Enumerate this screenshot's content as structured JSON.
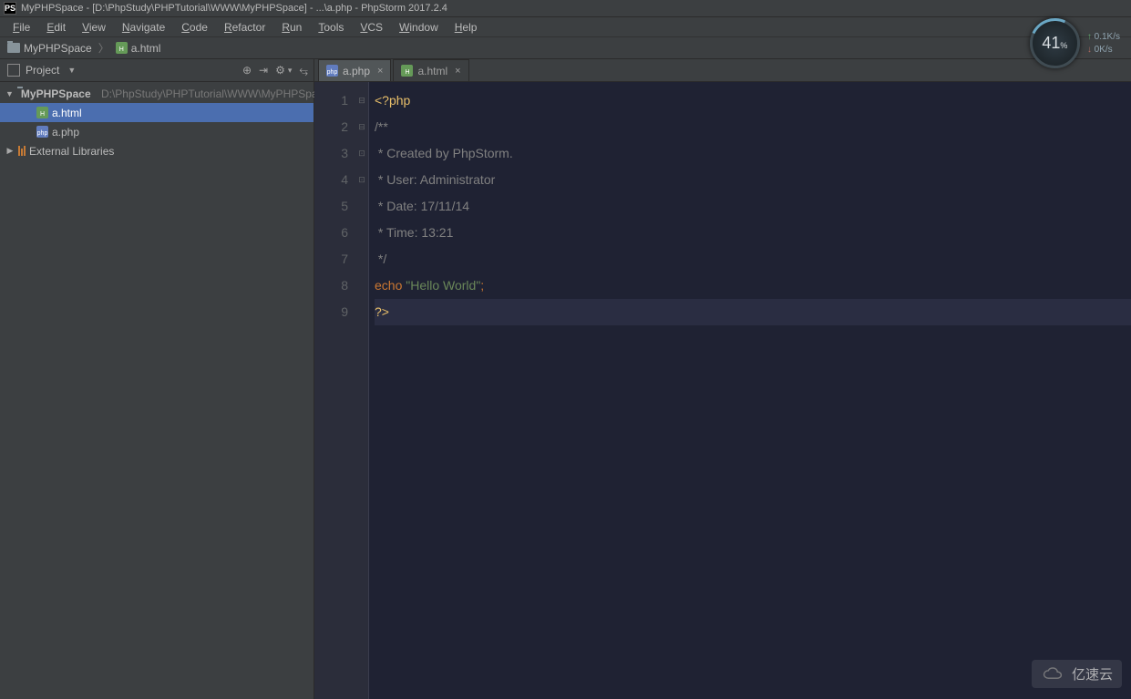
{
  "title_bar": "MyPHPSpace - [D:\\PhpStudy\\PHPTutorial\\WWW\\MyPHPSpace] - ...\\a.php - PhpStorm 2017.2.4",
  "logo_text": "PS",
  "menu": [
    "File",
    "Edit",
    "View",
    "Navigate",
    "Code",
    "Refactor",
    "Run",
    "Tools",
    "VCS",
    "Window",
    "Help"
  ],
  "breadcrumb": {
    "root": "MyPHPSpace",
    "file": "a.html"
  },
  "sidebar": {
    "header_label": "Project",
    "project_name": "MyPHPSpace",
    "project_path": "D:\\PhpStudy\\PHPTutorial\\WWW\\MyPHPSpace",
    "files": [
      {
        "name": "a.html",
        "type": "html",
        "selected": true
      },
      {
        "name": "a.php",
        "type": "php",
        "selected": false
      }
    ],
    "external_label": "External Libraries"
  },
  "tabs": [
    {
      "name": "a.php",
      "type": "php",
      "active": true
    },
    {
      "name": "a.html",
      "type": "html",
      "active": false
    }
  ],
  "code": {
    "lines": [
      {
        "n": "1",
        "seg": [
          {
            "t": "<?php",
            "c": "c-tag"
          }
        ]
      },
      {
        "n": "2",
        "seg": [
          {
            "t": "/**",
            "c": "c-comm"
          }
        ]
      },
      {
        "n": "3",
        "seg": [
          {
            "t": " * Created by PhpStorm.",
            "c": "c-comm"
          }
        ]
      },
      {
        "n": "4",
        "seg": [
          {
            "t": " * User: Administrator",
            "c": "c-comm"
          }
        ]
      },
      {
        "n": "5",
        "seg": [
          {
            "t": " * Date: 17/11/14",
            "c": "c-comm"
          }
        ]
      },
      {
        "n": "6",
        "seg": [
          {
            "t": " * Time: 13:21",
            "c": "c-comm"
          }
        ]
      },
      {
        "n": "7",
        "seg": [
          {
            "t": " */",
            "c": "c-comm"
          }
        ]
      },
      {
        "n": "8",
        "seg": [
          {
            "t": "echo",
            "c": "c-kw"
          },
          {
            "t": " "
          },
          {
            "t": "\"Hello World\"",
            "c": "c-str"
          },
          {
            "t": ";",
            "c": "c-semi"
          }
        ]
      },
      {
        "n": "9",
        "seg": [
          {
            "t": "?>",
            "c": "c-tag"
          }
        ],
        "caret": true
      }
    ]
  },
  "hud": {
    "percent": "41",
    "up": "0.1K/s",
    "down": "0K/s"
  },
  "watermark": "亿速云"
}
